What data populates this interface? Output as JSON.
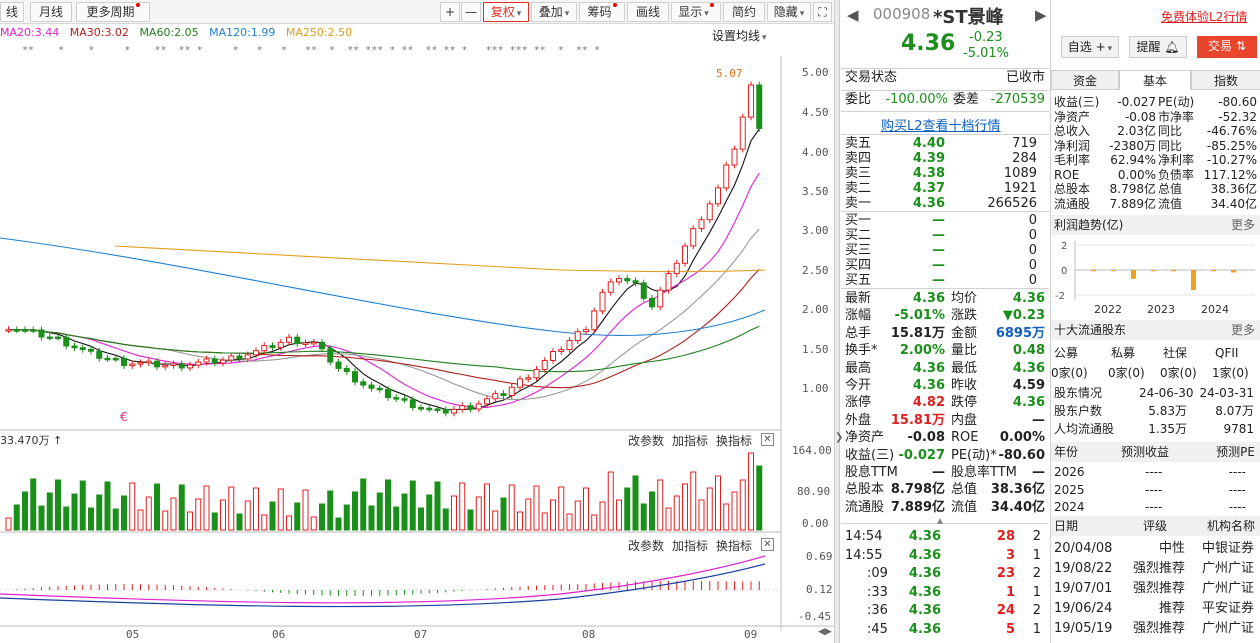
{
  "toolbar": {
    "left_items": [
      "线",
      "月线",
      "更多周期"
    ],
    "zoom_in": "+",
    "zoom_out": "—",
    "fuquan": "复权",
    "overlay": "叠加",
    "chips": "筹码",
    "draw": "画线",
    "display": "显示",
    "simple": "简约",
    "hide": "隐藏"
  },
  "ma_legend": {
    "ma20": "MA20:3.44",
    "ma30": "MA30:3.02",
    "ma60": "MA60:2.05",
    "ma120": "MA120:1.99",
    "ma250": "MA250:2.50",
    "setting": "设置均线"
  },
  "colors": {
    "ma20": "#e020d0",
    "ma30": "#b02020",
    "ma60": "#208020",
    "ma120": "#2080d0",
    "ma250": "#e0a020",
    "up": "#e02020",
    "down": "#1a8f1a",
    "black": "#111111"
  },
  "main_chart": {
    "y_ticks": [
      "5.00",
      "4.50",
      "4.00",
      "3.50",
      "3.00",
      "2.50",
      "2.00",
      "1.50",
      "1.00"
    ],
    "high_label": "5.07"
  },
  "volume_panel": {
    "title": "33.470万",
    "buttons": [
      "改参数",
      "加指标",
      "换指标"
    ],
    "y_ticks": [
      "164.00",
      "80.90",
      "0.00"
    ]
  },
  "macd_panel": {
    "buttons": [
      "改参数",
      "加指标",
      "换指标"
    ],
    "y_ticks": [
      "0.69",
      "0.12",
      "-0.45"
    ]
  },
  "x_axis": [
    "05",
    "06",
    "07",
    "08",
    "09"
  ],
  "stock": {
    "code": "000908",
    "name": "*ST景峰",
    "price": "4.36",
    "change": "-0.23",
    "change_pct": "-5.01%",
    "free_l2": "免费体验L2行情",
    "btn_watch": "自选",
    "btn_alert": "提醒",
    "btn_trade": "交易"
  },
  "status": {
    "label": "交易状态",
    "value": "已收市"
  },
  "weibi": {
    "label1": "委比",
    "val1": "-100.00%",
    "label2": "委差",
    "val2": "-270539"
  },
  "l2_link": "购买L2查看十档行情",
  "asks": [
    {
      "name": "卖五",
      "price": "4.40",
      "vol": "719"
    },
    {
      "name": "卖四",
      "price": "4.39",
      "vol": "284"
    },
    {
      "name": "卖三",
      "price": "4.38",
      "vol": "1089"
    },
    {
      "name": "卖二",
      "price": "4.37",
      "vol": "1921"
    },
    {
      "name": "卖一",
      "price": "4.36",
      "vol": "266526"
    }
  ],
  "bids": [
    {
      "name": "买一",
      "price": "—",
      "vol": "0"
    },
    {
      "name": "买二",
      "price": "—",
      "vol": "0"
    },
    {
      "name": "买三",
      "price": "—",
      "vol": "0"
    },
    {
      "name": "买四",
      "price": "—",
      "vol": "0"
    },
    {
      "name": "买五",
      "price": "—",
      "vol": "0"
    }
  ],
  "quote": [
    {
      "l1": "最新",
      "v1": "4.36",
      "l2": "均价",
      "v2": "4.36"
    },
    {
      "l1": "涨幅",
      "v1": "-5.01%",
      "l2": "涨跌",
      "v2": "▼0.23"
    },
    {
      "l1": "总手",
      "v1": "15.81万",
      "l2": "金额",
      "v2": "6895万"
    },
    {
      "l1": "换手*",
      "v1": "2.00%",
      "l2": "量比",
      "v2": "0.48"
    },
    {
      "l1": "最高",
      "v1": "4.36",
      "l2": "最低",
      "v2": "4.36"
    },
    {
      "l1": "今开",
      "v1": "4.36",
      "l2": "昨收",
      "v2": "4.59"
    },
    {
      "l1": "涨停",
      "v1": "4.82",
      "l2": "跌停",
      "v2": "4.36"
    },
    {
      "l1": "外盘",
      "v1": "15.81万",
      "l2": "内盘",
      "v2": "—"
    },
    {
      "l1": "净资产",
      "v1": "-0.08",
      "l2": "ROE",
      "v2": "0.00%"
    },
    {
      "l1": "收益(三)",
      "v1": "-0.027",
      "l2": "PE(动)*",
      "v2": "-80.60"
    },
    {
      "l1": "股息TTM",
      "v1": "—",
      "l2": "股息率TTM",
      "v2": "—"
    },
    {
      "l1": "总股本",
      "v1": "8.798亿",
      "l2": "总值",
      "v2": "38.36亿"
    },
    {
      "l1": "流通股",
      "v1": "7.889亿",
      "l2": "流值",
      "v2": "34.40亿"
    }
  ],
  "ticks": [
    {
      "time": "14:54",
      "price": "4.36",
      "vol": "28",
      "n": "2"
    },
    {
      "time": "14:55",
      "price": "4.36",
      "vol": "3",
      "n": "1"
    },
    {
      "time": ":09",
      "price": "4.36",
      "vol": "23",
      "n": "2"
    },
    {
      "time": ":33",
      "price": "4.36",
      "vol": "1",
      "n": "1"
    },
    {
      "time": ":36",
      "price": "4.36",
      "vol": "24",
      "n": "2"
    },
    {
      "time": ":45",
      "price": "4.36",
      "vol": "5",
      "n": "1"
    }
  ],
  "right_tabs": [
    "资金",
    "基本",
    "指数"
  ],
  "fundamentals": [
    {
      "l1": "收益(三)",
      "v1": "-0.027",
      "l2": "PE(动)",
      "v2": "-80.60"
    },
    {
      "l1": "净资产",
      "v1": "-0.08",
      "l2": "市净率",
      "v2": "-52.32"
    },
    {
      "l1": "总收入",
      "v1": "2.03亿",
      "l2": "同比",
      "v2": "-46.76%"
    },
    {
      "l1": "净利润",
      "v1": "-2380万",
      "l2": "同比",
      "v2": "-85.25%"
    },
    {
      "l1": "毛利率",
      "v1": "62.94%",
      "l2": "净利率",
      "v2": "-10.27%"
    },
    {
      "l1": "ROE",
      "v1": "0.00%",
      "l2": "负债率",
      "v2": "117.12%"
    },
    {
      "l1": "总股本",
      "v1": "8.798亿",
      "l2": "总值",
      "v2": "38.36亿"
    },
    {
      "l1": "流通股",
      "v1": "7.889亿",
      "l2": "流值",
      "v2": "34.40亿"
    }
  ],
  "profit": {
    "title": "利润趋势(亿)",
    "more": "更多",
    "y_ticks": [
      "2",
      "0",
      "-2"
    ],
    "years": [
      "2022",
      "2023",
      "2024"
    ]
  },
  "chart_data": {
    "type": "bar",
    "title": "利润趋势(亿)",
    "categories": [
      "2022",
      "2023",
      "2024"
    ],
    "ylim": [
      -2,
      2
    ],
    "series": [
      {
        "values": [
          -0.1,
          -0.1,
          -0.7,
          -0.1,
          -0.1,
          -1.6,
          -0.1,
          -0.2
        ]
      }
    ]
  },
  "holders": {
    "title": "十大流通股东",
    "more": "更多",
    "types": [
      "公募",
      "私募",
      "社保",
      "QFII"
    ],
    "counts": [
      "0家(0)",
      "0家(0)",
      "0家(0)",
      "1家(0)"
    ],
    "rows": [
      {
        "l": "股东情况",
        "a": "24-06-30",
        "b": "24-03-31"
      },
      {
        "l": "股东户数",
        "a": "5.83万",
        "b": "8.07万"
      },
      {
        "l": "人均流通股",
        "a": "1.35万",
        "b": "9781"
      }
    ]
  },
  "forecast": {
    "headers": [
      "年份",
      "预测收益",
      "预测PE"
    ],
    "rows": [
      {
        "y": "2026",
        "a": "----",
        "b": "----"
      },
      {
        "y": "2025",
        "a": "----",
        "b": "----"
      },
      {
        "y": "2024",
        "a": "----",
        "b": "----"
      }
    ]
  },
  "ratings": {
    "headers": [
      "日期",
      "评级",
      "机构名称"
    ],
    "rows": [
      {
        "d": "20/04/08",
        "r": "中性",
        "o": "中银证券"
      },
      {
        "d": "19/08/22",
        "r": "强烈推荐",
        "o": "广州广证"
      },
      {
        "d": "19/07/01",
        "r": "强烈推荐",
        "o": "广州广证"
      },
      {
        "d": "19/06/24",
        "r": "推荐",
        "o": "平安证券"
      },
      {
        "d": "19/05/19",
        "r": "强烈推荐",
        "o": "广州广证"
      }
    ]
  }
}
